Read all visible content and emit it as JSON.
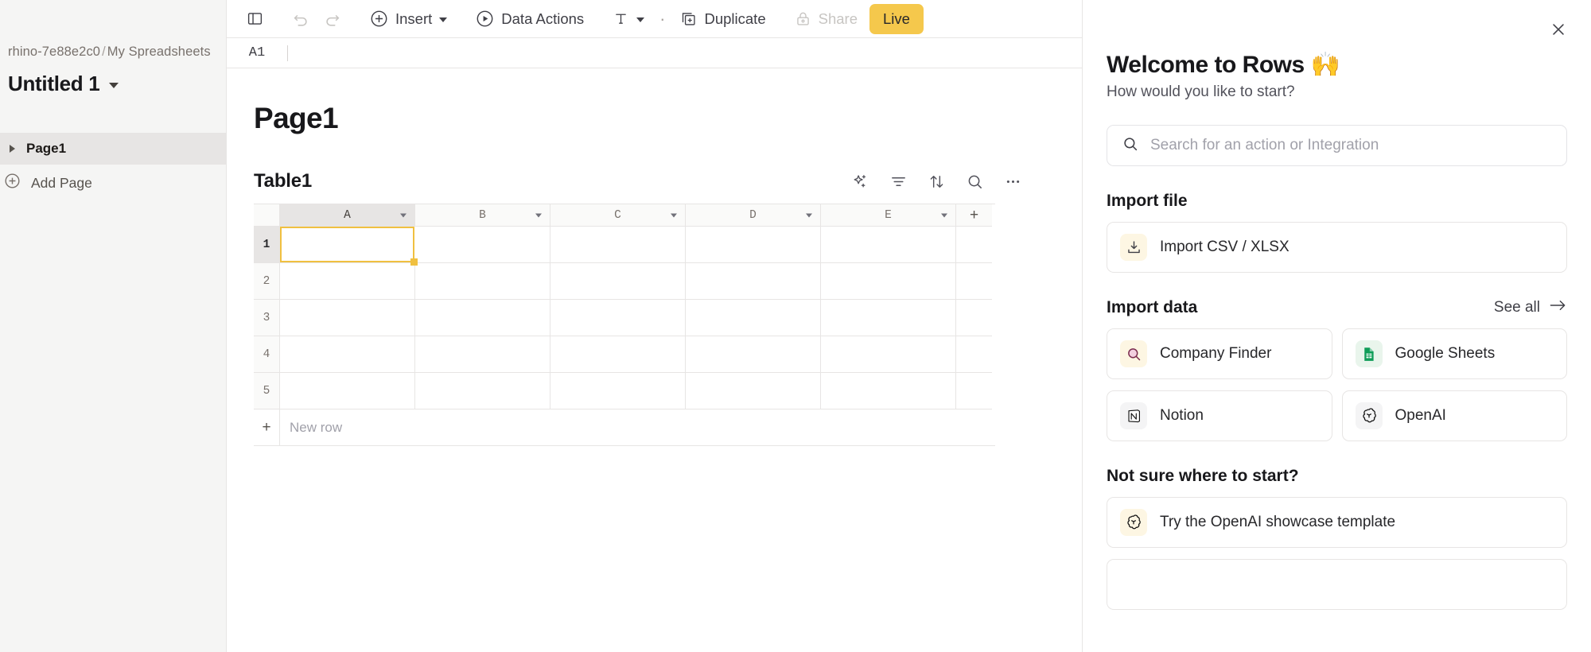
{
  "sidebar": {
    "breadcrumb": {
      "workspace": "rhino-7e88e2c0",
      "separator": "/",
      "folder": "My Spreadsheets"
    },
    "document_title": "Untitled 1",
    "title_caret_icon": "chevron-down-icon",
    "pages": [
      {
        "label": "Page1",
        "expand_icon": "triangle-right-icon",
        "selected": true
      }
    ],
    "add_page": {
      "label": "Add Page",
      "icon": "plus-circle-icon"
    }
  },
  "toolbar": {
    "sidebar_toggle_icon": "panel-left-icon",
    "undo": {
      "label": "Undo",
      "icon": "undo-arrow-icon",
      "disabled": true
    },
    "redo": {
      "label": "Redo",
      "icon": "redo-arrow-icon",
      "disabled": true
    },
    "insert": {
      "label": "Insert",
      "icon": "plus-circle-icon",
      "caret_icon": "chevron-down-icon"
    },
    "data_actions": {
      "label": "Data Actions",
      "icon": "play-circle-icon"
    },
    "text_format": {
      "label": "T",
      "icon": "text-format-icon",
      "caret_icon": "chevron-down-icon"
    },
    "separator_dot": "·",
    "duplicate": {
      "label": "Duplicate",
      "icon": "duplicate-icon"
    },
    "share": {
      "label": "Share",
      "icon": "lock-icon",
      "disabled": true
    },
    "live": {
      "label": "Live",
      "color": "#f5c84c"
    }
  },
  "formula_bar": {
    "cell_reference": "A1",
    "value": ""
  },
  "canvas": {
    "page_heading": "Page1",
    "table": {
      "name": "Table1",
      "tools": [
        {
          "name": "ai-sparkle-icon"
        },
        {
          "name": "filter-icon"
        },
        {
          "name": "sort-icon"
        },
        {
          "name": "search-icon"
        },
        {
          "name": "more-options-icon"
        }
      ],
      "columns": [
        "A",
        "B",
        "C",
        "D",
        "E"
      ],
      "add_column_label": "+",
      "rows": [
        "1",
        "2",
        "3",
        "4",
        "5"
      ],
      "selected_cell": "A1",
      "selection_color": "#f0c040",
      "new_row_label": "New row",
      "new_row_icon": "plus-icon"
    }
  },
  "panel": {
    "close_icon": "close-icon",
    "title": "Welcome to Rows 🙌",
    "subtitle": "How would you like to start?",
    "search": {
      "placeholder": "Search for an action or Integration",
      "value": "",
      "icon": "search-icon"
    },
    "import_file": {
      "heading": "Import file",
      "items": [
        {
          "label": "Import CSV / XLSX",
          "icon": "import-tray-icon",
          "icon_bg": "#fdf6e3"
        }
      ]
    },
    "import_data": {
      "heading": "Import data",
      "see_all": {
        "label": "See all",
        "icon": "arrow-right-icon"
      },
      "items": [
        {
          "label": "Company Finder",
          "icon": "company-finder-icon",
          "icon_bg": "#fdf6e3"
        },
        {
          "label": "Google Sheets",
          "icon": "google-sheets-icon",
          "icon_bg": "#e9f5ec"
        },
        {
          "label": "Notion",
          "icon": "notion-icon",
          "icon_bg": "#f4f4f5"
        },
        {
          "label": "OpenAI",
          "icon": "openai-icon",
          "icon_bg": "#f4f4f5"
        }
      ]
    },
    "not_sure": {
      "heading": "Not sure where to start?",
      "items": [
        {
          "label": "Try the OpenAI showcase template",
          "icon": "openai-icon",
          "icon_bg": "#fdf6e3"
        }
      ]
    }
  }
}
